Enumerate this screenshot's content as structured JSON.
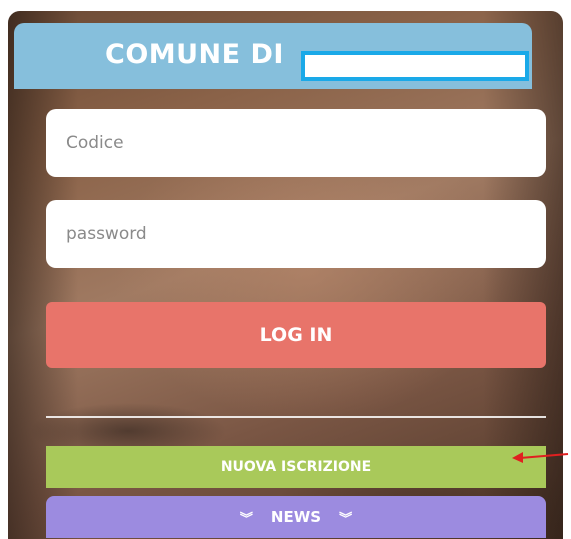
{
  "header": {
    "title": "COMUNE DI"
  },
  "login_form": {
    "code_placeholder": "Codice",
    "password_placeholder": "password",
    "login_label": "LOG IN"
  },
  "actions": {
    "new_registration_label": "NUOVA ISCRIZIONE",
    "news_label": "NEWS",
    "news_icon": "double-chevron-down-icon"
  },
  "colors": {
    "header": "#86bfdc",
    "name_box_border": "#1aa9e8",
    "login": "#e8746a",
    "new_registration": "#a9c95a",
    "news": "#9c8be0",
    "annotation_arrow": "#e02020"
  }
}
